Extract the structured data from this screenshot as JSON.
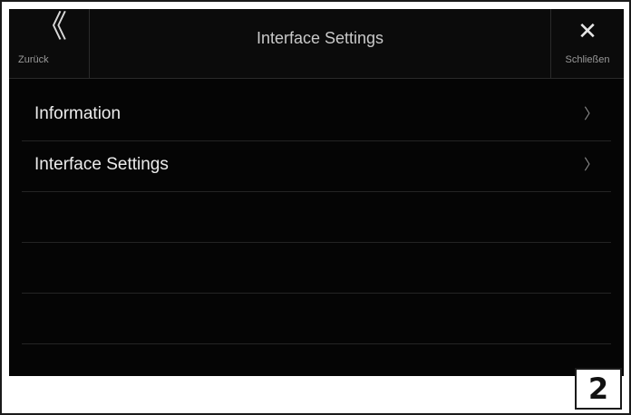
{
  "header": {
    "back_glyph": "《",
    "back_label": "Zurück",
    "title": "Interface Settings",
    "close_glyph": "✕",
    "close_label": "Schließen"
  },
  "menu": {
    "items": [
      {
        "label": "Information",
        "chevron": "〉"
      },
      {
        "label": "Interface Settings",
        "chevron": "〉"
      }
    ]
  },
  "step_badge": "2",
  "colors": {
    "screen_bg": "#050505",
    "text_primary": "#ececec",
    "separator": "#242424"
  }
}
